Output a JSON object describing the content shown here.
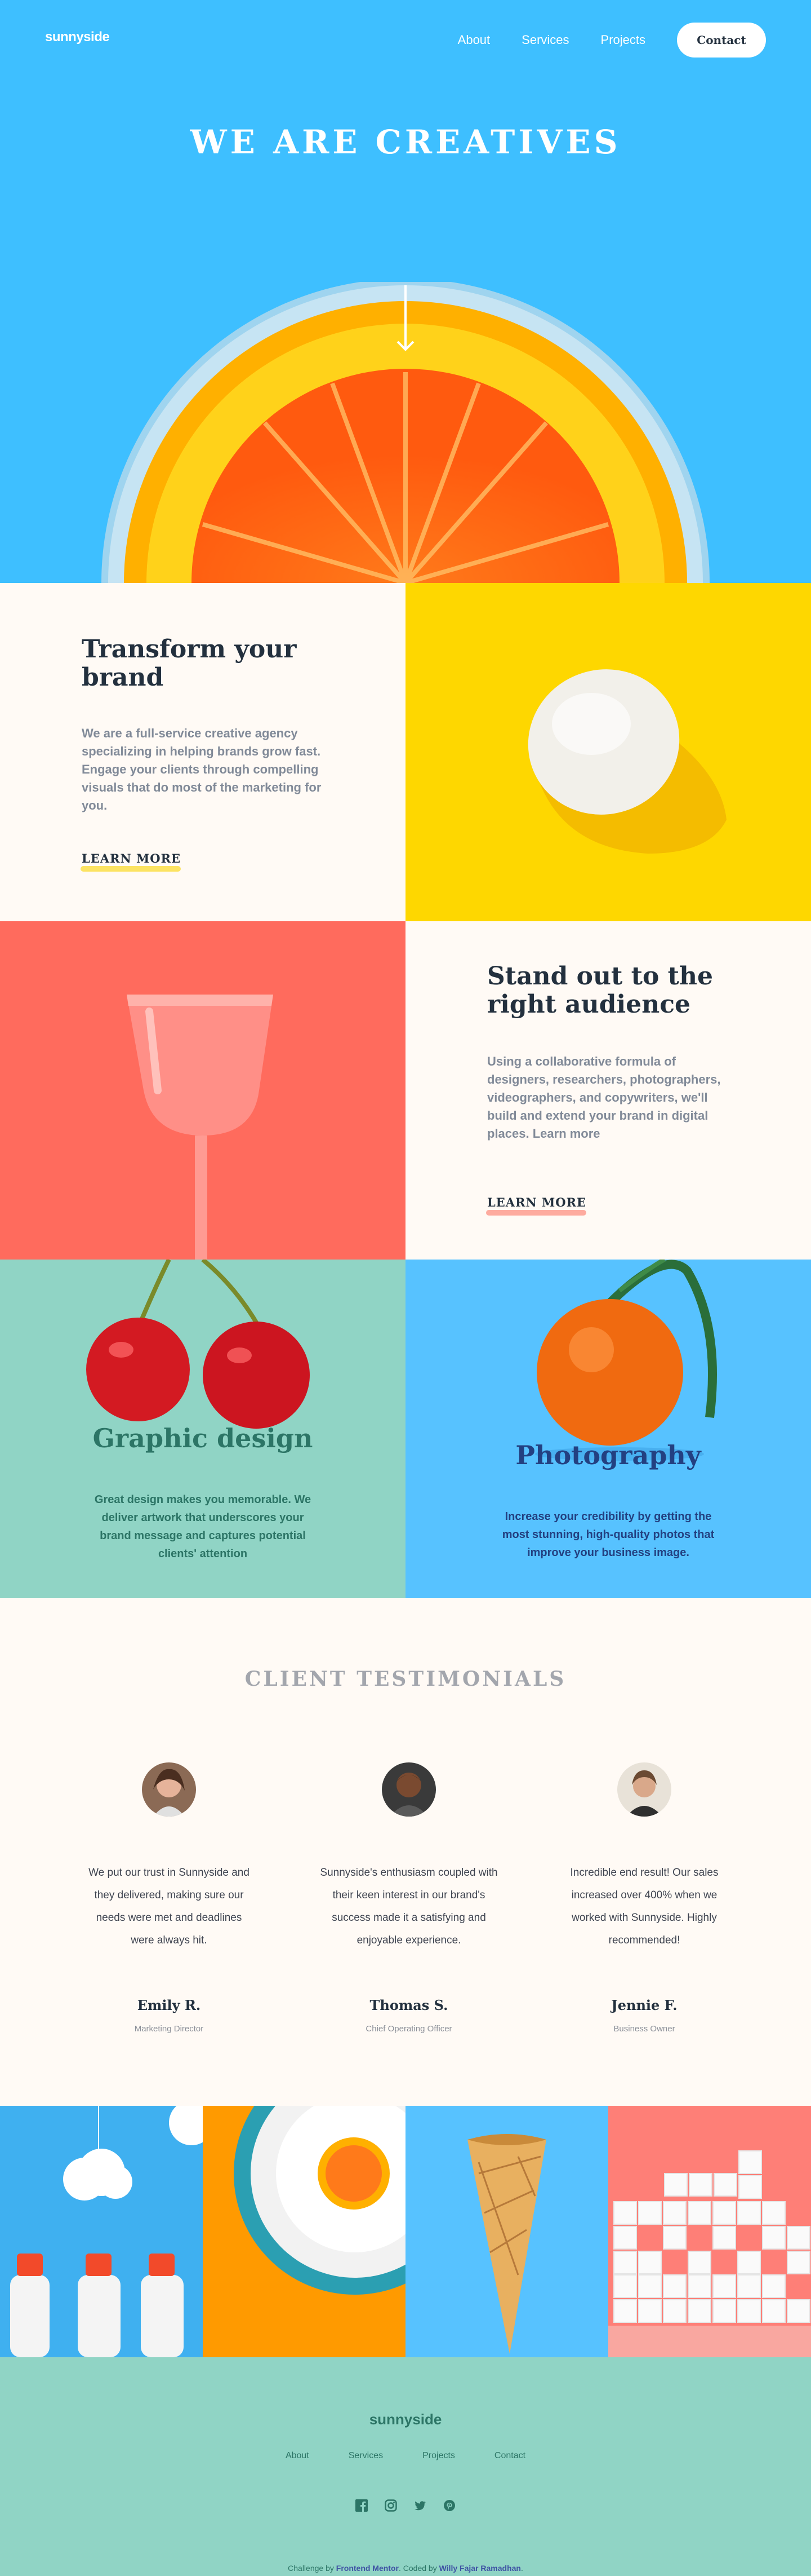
{
  "header": {
    "logo": "sunnyside",
    "nav": [
      "About",
      "Services",
      "Projects"
    ],
    "contact_label": "Contact",
    "hero_title": "WE ARE CREATIVES",
    "icons": [
      "arrow-down-icon"
    ]
  },
  "features": {
    "transform": {
      "title_line1": "Transform your",
      "title_line2": "brand",
      "text": "We are a full-service creative agency specializing in helping brands grow fast. Engage your clients through compelling visuals that do most of the marketing for you.",
      "learn_more": "LEARN MORE",
      "accent": "#fad400"
    },
    "standout": {
      "title_line1": "Stand out to the",
      "title_line2": "right audience",
      "text": "Using a collaborative formula of designers, researchers, photographers, videographers, and copywriters, we'll build and extend your brand in digital places. Learn more",
      "learn_more": "LEARN MORE",
      "accent": "#fe7766"
    }
  },
  "services": {
    "graphic": {
      "title": "Graphic design",
      "text": "Great design makes you memorable. We deliver artwork that underscores your brand message and captures potential clients' attention",
      "color": "#2c7566",
      "bg": "#90d4c5"
    },
    "photo": {
      "title": "Photography",
      "text": "Increase your credibility by getting the most stunning, high-quality photos that improve your business image.",
      "color": "#234081",
      "bg": "#57c2ff"
    }
  },
  "testimonials": {
    "heading": "CLIENT TESTIMONIALS",
    "items": [
      {
        "quote_lines": [
          "We put our trust in Sunnyside and",
          "they delivered, making sure our",
          "needs were met and deadlines",
          "were always hit."
        ],
        "name": "Emily R.",
        "role": "Marketing Director"
      },
      {
        "quote_lines": [
          "Sunnyside's enthusiasm coupled with",
          "their keen interest in our brand's",
          "success made it a satisfying and",
          "enjoyable experience."
        ],
        "name": "Thomas S.",
        "role": "Chief Operating Officer"
      },
      {
        "quote_lines": [
          "Incredible end result! Our sales",
          "increased over 400% when we",
          "worked with Sunnyside. Highly",
          "recommended!"
        ],
        "name": "Jennie F.",
        "role": "Business Owner"
      }
    ]
  },
  "footer": {
    "logo": "sunnyside",
    "nav": [
      "About",
      "Services",
      "Projects",
      "Contact"
    ],
    "social_icons": [
      "facebook-icon",
      "instagram-icon",
      "twitter-icon",
      "pinterest-icon"
    ],
    "attribution_prefix": "Challenge by ",
    "attribution_fm": "Frontend Mentor",
    "attribution_mid": ". Coded by ",
    "attribution_author": "Willy Fajar Ramadhan",
    "attribution_suffix": "."
  },
  "colors": {
    "hero_bg": "#3ebfff",
    "yellow": "#fed700",
    "coral": "#ff6b5d",
    "mint": "#90d4c5",
    "sky": "#57c2ff",
    "dark": "#23303e"
  }
}
